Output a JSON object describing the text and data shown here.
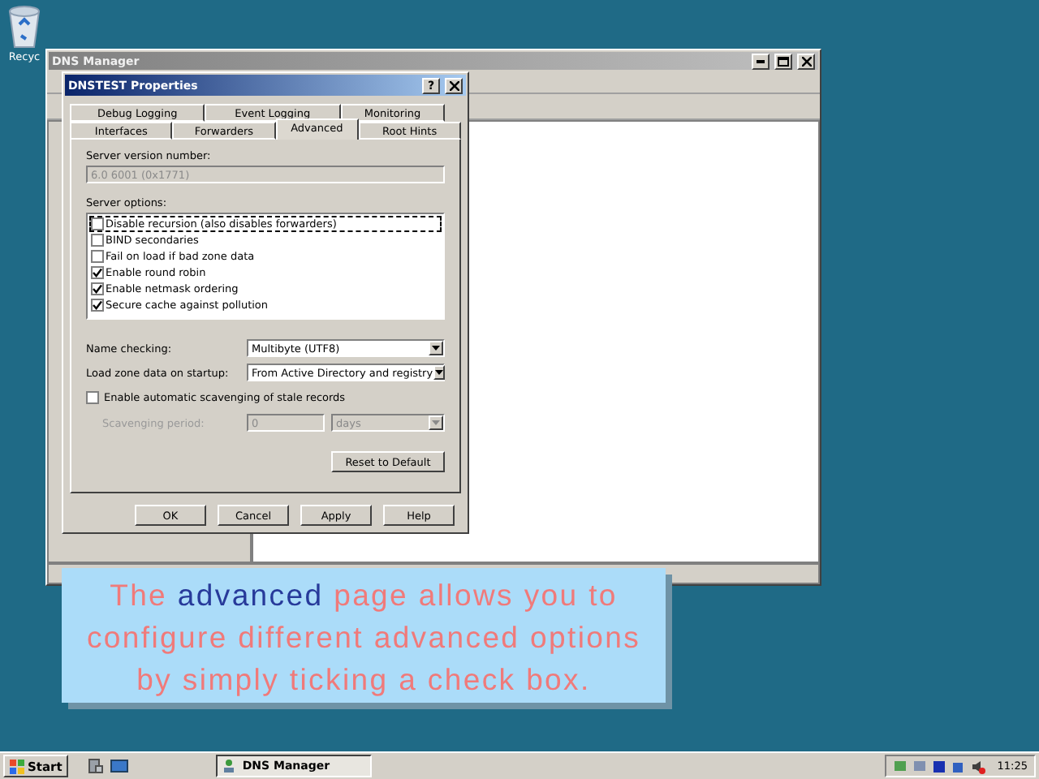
{
  "desktop_icons": [
    {
      "label": "Recyc"
    }
  ],
  "main_window": {
    "title": "DNS Manager"
  },
  "dialog": {
    "title": "DNSTEST Properties",
    "help_button": "?",
    "tab_rows": [
      {
        "tabs": [
          {
            "label": "Debug Logging",
            "selected": false
          },
          {
            "label": "Event Logging",
            "selected": false
          },
          {
            "label": "Monitoring",
            "selected": false
          }
        ]
      },
      {
        "tabs": [
          {
            "label": "Interfaces",
            "selected": false
          },
          {
            "label": "Forwarders",
            "selected": false
          },
          {
            "label": "Advanced",
            "selected": true
          },
          {
            "label": "Root Hints",
            "selected": false
          }
        ]
      }
    ],
    "server_version": {
      "label": "Server version number:",
      "value": "6.0 6001 (0x1771)",
      "disabled": true
    },
    "server_options": {
      "label": "Server options:",
      "items": [
        {
          "label": "Disable recursion (also disables forwarders)",
          "checked": false,
          "focused": true
        },
        {
          "label": "BIND secondaries",
          "checked": false,
          "focused": false
        },
        {
          "label": "Fail on load if bad zone data",
          "checked": false,
          "focused": false
        },
        {
          "label": "Enable round robin",
          "checked": true,
          "focused": false
        },
        {
          "label": "Enable netmask ordering",
          "checked": true,
          "focused": false
        },
        {
          "label": "Secure cache against pollution",
          "checked": true,
          "focused": false
        }
      ]
    },
    "name_checking": {
      "label": "Name checking:",
      "value": "Multibyte (UTF8)"
    },
    "load_zone": {
      "label": "Load zone data on startup:",
      "value": "From Active Directory and registry"
    },
    "scavenging": {
      "label": "Enable automatic scavenging of stale records",
      "checked": false,
      "period_label": "Scavenging period:",
      "period_value": "0",
      "unit": "days",
      "disabled": true
    },
    "reset_button": "Reset to Default",
    "buttons": [
      "OK",
      "Cancel",
      "Apply",
      "Help"
    ]
  },
  "caption": [
    {
      "text": "The ",
      "highlight": false
    },
    {
      "text": "advanced",
      "highlight": true
    },
    {
      "text": " page allows you to configure different advanced options by simply ticking a check box.",
      "highlight": false
    }
  ],
  "taskbar": {
    "start": "Start",
    "tasks": [
      {
        "label": "DNS Manager",
        "selected": true
      }
    ],
    "clock": "11:25"
  }
}
